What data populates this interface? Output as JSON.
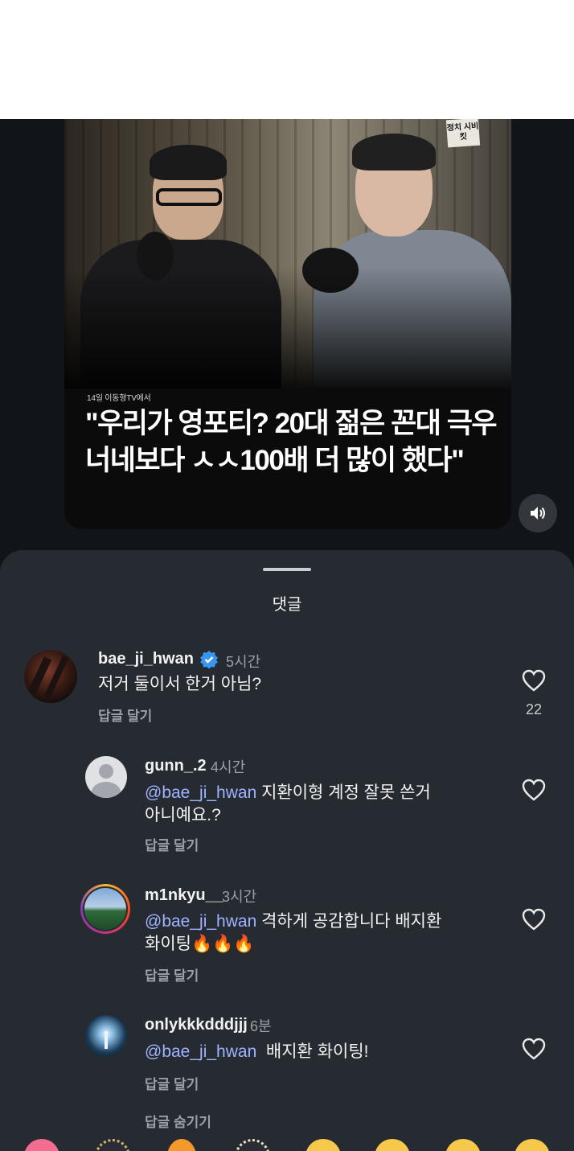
{
  "video": {
    "channel_line": "14일 이동형TV에서",
    "headline_line1": "\"우리가 영포티? 20대 젊은 꼰대 극우",
    "headline_line2": "너네보다 ㅅㅅ100배 더 많이 했다\"",
    "logo_text": "정치 시비킷",
    "volume_icon": "speaker-icon"
  },
  "sheet": {
    "title": "댓글"
  },
  "comments": [
    {
      "username": "bae_ji_hwan",
      "verified": true,
      "time": "5시간",
      "text": "저거 둘이서 한거 아님?",
      "reply_label": "답글 달기",
      "likes": "22"
    },
    {
      "username": "gunn_.2",
      "time": "4시간",
      "mention": "@bae_ji_hwan",
      "text_line1": " 지환이형 계정 잘못 쓴거",
      "text_line2": "아니예요.?",
      "reply_label": "답글 달기"
    },
    {
      "username": "m1nkyu__",
      "time": "3시간",
      "mention": "@bae_ji_hwan",
      "text_line1": " 격하게 공감합니다 배지환",
      "text_line2": "화이팅🔥🔥🔥",
      "reply_label": "답글 달기"
    },
    {
      "username": "onlykkkdddjjj",
      "time": "6분",
      "mention": "@bae_ji_hwan",
      "text_line1": "  배지환 화이팅!",
      "reply_label": "답글 달기"
    }
  ],
  "hide_replies_label": "답글 숨기기",
  "colors": {
    "background": "#111419",
    "sheet": "#262a31",
    "mention": "#9fb3ff",
    "verified": "#3797f0"
  }
}
